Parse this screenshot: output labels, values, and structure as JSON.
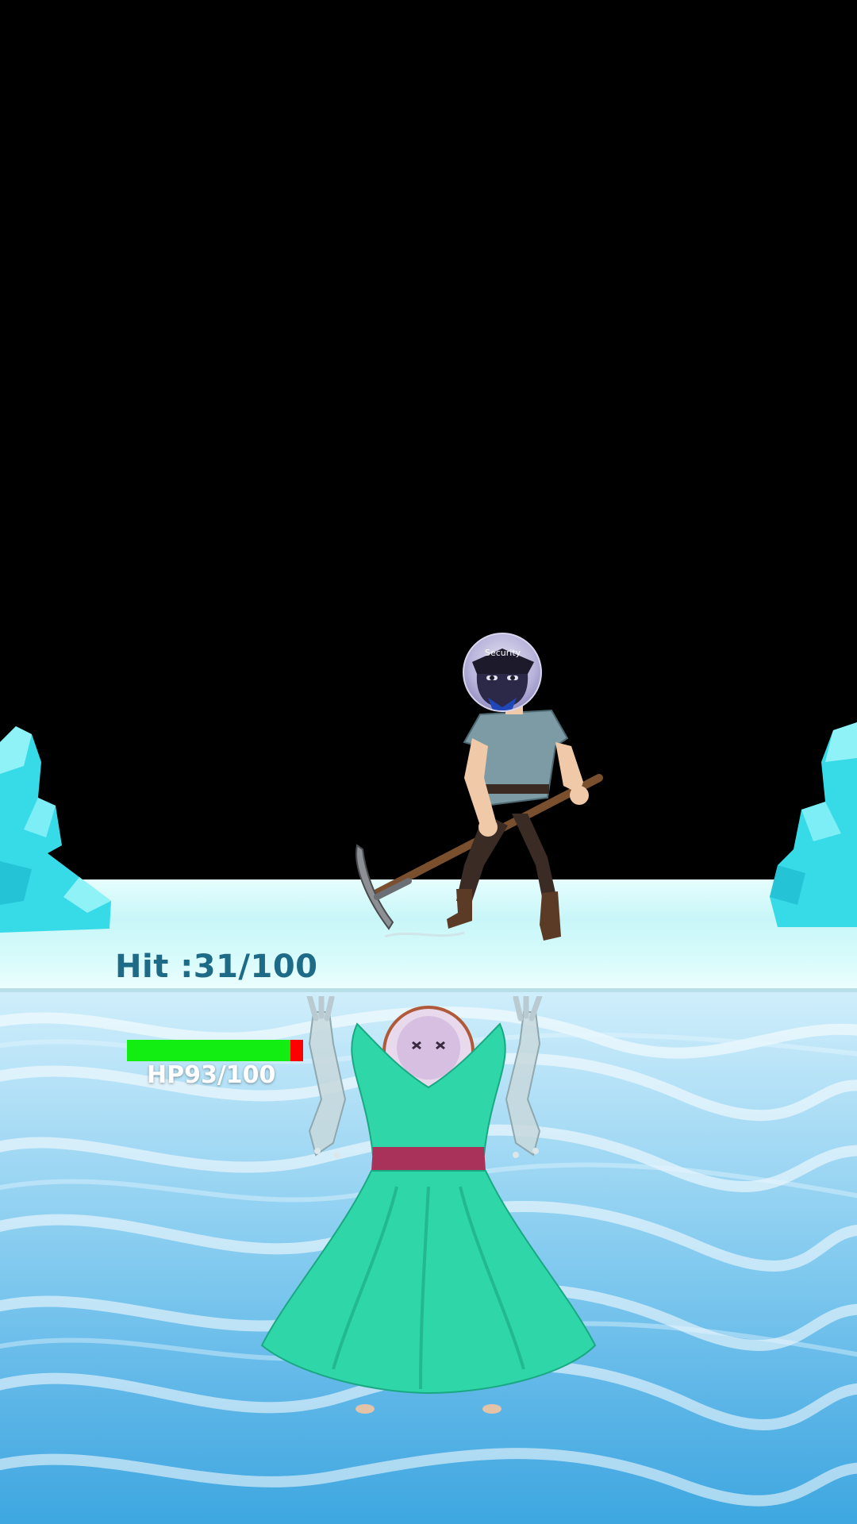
{
  "hud": {
    "hit_label": "Hit :31/100",
    "hit_current": 31,
    "hit_max": 100,
    "hp_label": "HP93/100",
    "hp_current": 93,
    "hp_max": 100,
    "hp_fraction": 0.93
  },
  "player": {
    "badge_text": "Security"
  },
  "colors": {
    "hp_fill": "#12ee12",
    "hp_empty": "#ff0000",
    "hit_text": "#1e6b88",
    "dress": "#2fd6a8",
    "belt": "#a8325a",
    "ice": "#3fdfea"
  },
  "icons": {
    "player": "miner-with-pickaxe",
    "enemy": "frozen-dress-monster",
    "scenery": "ice-crystal"
  }
}
